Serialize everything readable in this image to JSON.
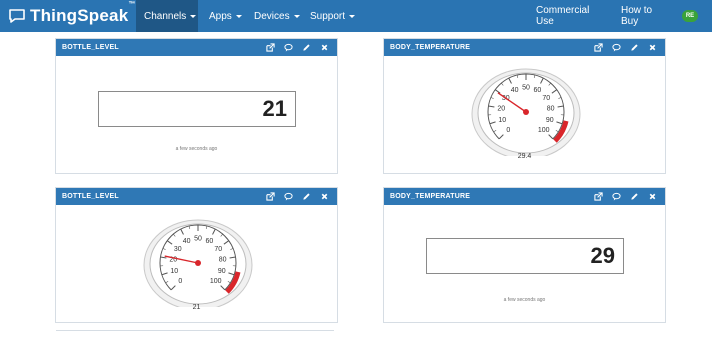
{
  "navbar": {
    "brand": "ThingSpeak",
    "brand_tm": "™",
    "items": [
      {
        "label": "Channels",
        "active": true
      },
      {
        "label": "Apps"
      },
      {
        "label": "Devices"
      },
      {
        "label": "Support"
      }
    ],
    "right_items": [
      {
        "label": "Commercial Use"
      },
      {
        "label": "How to Buy"
      }
    ],
    "avatar": "RE"
  },
  "widgets": [
    {
      "title": "BOTTLE_LEVEL",
      "type": "numeric",
      "value": "21",
      "timestamp": "a few seconds ago"
    },
    {
      "title": "BODY_TEMPERATURE",
      "type": "gauge",
      "value": "29.4",
      "needle_value": 29.4,
      "ticks": [
        "0",
        "10",
        "20",
        "30",
        "40",
        "50",
        "60",
        "70",
        "80",
        "90",
        "100"
      ],
      "danger_color": "#d9262b"
    },
    {
      "title": "BOTTLE_LEVEL",
      "type": "gauge",
      "value": "21",
      "needle_value": 21,
      "ticks": [
        "0",
        "10",
        "20",
        "30",
        "40",
        "50",
        "60",
        "70",
        "80",
        "90",
        "100"
      ],
      "danger_color": "#d9262b"
    },
    {
      "title": "BODY_TEMPERATURE",
      "type": "numeric",
      "value": "29",
      "timestamp": "a few seconds ago"
    }
  ],
  "tool_icons": [
    "external-link-icon",
    "comment-icon",
    "pencil-icon",
    "close-icon"
  ],
  "colors": {
    "nav": "#2a74b2",
    "widget_header": "#2f78b5",
    "needle": "#d9262b"
  }
}
